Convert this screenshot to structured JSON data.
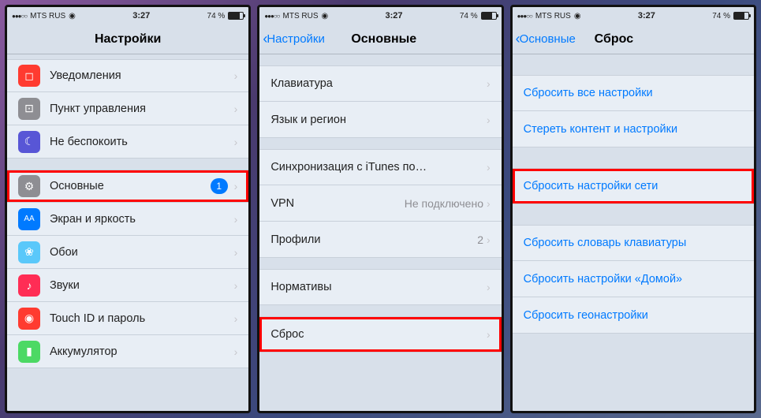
{
  "status": {
    "carrier": "MTS RUS",
    "time": "3:27",
    "battery": "74 %"
  },
  "screen1": {
    "title": "Настройки",
    "items": [
      {
        "label": "Уведомления",
        "icon": "notif"
      },
      {
        "label": "Пункт управления",
        "icon": "control"
      },
      {
        "label": "Не беспокоить",
        "icon": "dnd"
      },
      {
        "label": "Основные",
        "icon": "general",
        "badge": "1",
        "highlight": true
      },
      {
        "label": "Экран и яркость",
        "icon": "display"
      },
      {
        "label": "Обои",
        "icon": "wallpaper"
      },
      {
        "label": "Звуки",
        "icon": "sounds"
      },
      {
        "label": "Touch ID и пароль",
        "icon": "touchid"
      },
      {
        "label": "Аккумулятор",
        "icon": "battery"
      }
    ]
  },
  "screen2": {
    "back": "Настройки",
    "title": "Основные",
    "groups": [
      [
        {
          "label": "Клавиатура"
        },
        {
          "label": "Язык и регион"
        }
      ],
      [
        {
          "label": "Синхронизация с iTunes по…"
        },
        {
          "label": "VPN",
          "value": "Не подключено"
        },
        {
          "label": "Профили",
          "value": "2"
        }
      ],
      [
        {
          "label": "Нормативы"
        }
      ],
      [
        {
          "label": "Сброс",
          "highlight": true
        }
      ]
    ]
  },
  "screen3": {
    "back": "Основные",
    "title": "Сброс",
    "groups": [
      [
        {
          "label": "Сбросить все настройки"
        },
        {
          "label": "Стереть контент и настройки"
        }
      ],
      [
        {
          "label": "Сбросить настройки сети",
          "highlight": true
        }
      ],
      [
        {
          "label": "Сбросить словарь клавиатуры"
        },
        {
          "label": "Сбросить настройки «Домой»"
        },
        {
          "label": "Сбросить геонастройки"
        }
      ]
    ]
  }
}
